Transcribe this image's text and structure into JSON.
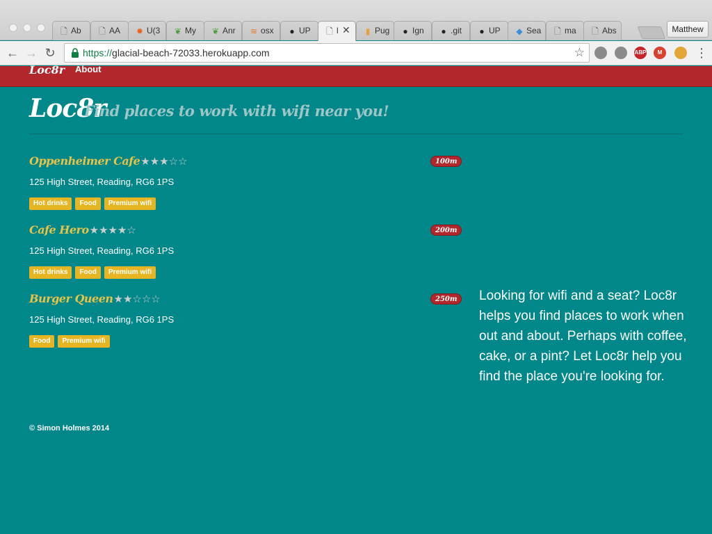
{
  "browser": {
    "tabs": [
      {
        "icon": "document-icon",
        "label": "Ab"
      },
      {
        "icon": "document-icon",
        "label": "AA"
      },
      {
        "icon": "gear-icon",
        "label": "U(3"
      },
      {
        "icon": "leaf-icon",
        "label": "My"
      },
      {
        "icon": "leaf-icon",
        "label": "Anr"
      },
      {
        "icon": "stack-icon",
        "label": "osx"
      },
      {
        "icon": "github-icon",
        "label": "UP"
      },
      {
        "icon": "document-icon",
        "label": "l"
      },
      {
        "icon": "bars-icon",
        "label": "Pug"
      },
      {
        "icon": "github-icon",
        "label": "Ign"
      },
      {
        "icon": "github-icon",
        "label": ".git"
      },
      {
        "icon": "github-icon",
        "label": "UP"
      },
      {
        "icon": "maps-icon",
        "label": "Sea"
      },
      {
        "icon": "document-icon",
        "label": "ma"
      },
      {
        "icon": "document-icon",
        "label": "Abs"
      }
    ],
    "active_tab_close": "✕",
    "profile_name": "Matthew",
    "url_scheme": "https://",
    "url_host": "glacial-beach-72033.herokuapp.com",
    "extensions": [
      {
        "name": "drive-icon",
        "label": "",
        "color": "#8a8a8a"
      },
      {
        "name": "dropbox-icon",
        "label": "",
        "color": "#8a8a8a"
      },
      {
        "name": "adblock-icon",
        "label": "ABP",
        "color": "#c8242b"
      },
      {
        "name": "momentum-icon",
        "label": "M",
        "color": "#d8412f"
      },
      {
        "name": "owl-icon",
        "label": "",
        "color": "#e3a63a"
      }
    ]
  },
  "nav": {
    "brand": "Loc8r",
    "about": "About"
  },
  "hero": {
    "title": "Loc8r",
    "subtitle": "Find places to work with wifi near you!"
  },
  "locations": [
    {
      "name": "Oppenheimer Cafe",
      "stars": "★★★☆☆",
      "rating": 3,
      "distance": "100m",
      "address": "125 High Street, Reading, RG6 1PS",
      "facilities": [
        "Hot drinks",
        "Food",
        "Premium wifi"
      ]
    },
    {
      "name": "Cafe Hero",
      "stars": "★★★★☆",
      "rating": 4,
      "distance": "200m",
      "address": "125 High Street, Reading, RG6 1PS",
      "facilities": [
        "Hot drinks",
        "Food",
        "Premium wifi"
      ]
    },
    {
      "name": "Burger Queen",
      "stars": "★★☆☆☆",
      "rating": 2,
      "distance": "250m",
      "address": "125 High Street, Reading, RG6 1PS",
      "facilities": [
        "Food",
        "Premium wifi"
      ]
    }
  ],
  "sidebar": {
    "text": "Looking for wifi and a seat? Loc8r helps you find places to work when out and about. Perhaps with coffee, cake, or a pint? Let Loc8r help you find the place you're looking for."
  },
  "footer": {
    "copyright": "© Simon Holmes 2014"
  }
}
